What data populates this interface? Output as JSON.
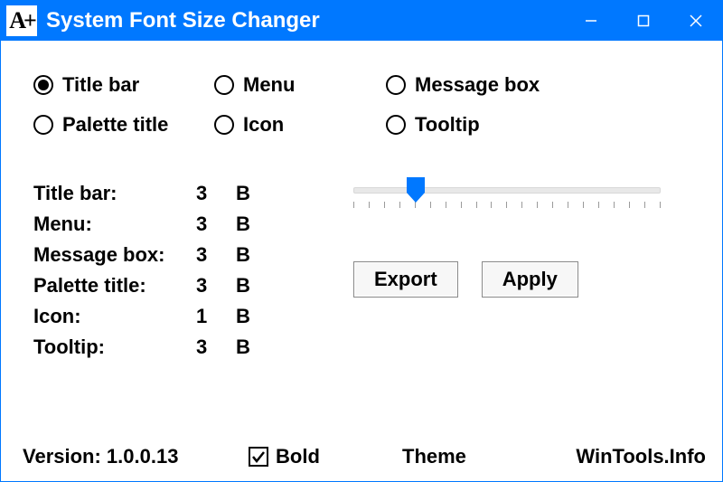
{
  "titlebar": {
    "icon_text": "A+",
    "title": "System Font Size Changer"
  },
  "radios": [
    {
      "label": "Title bar",
      "selected": true
    },
    {
      "label": "Menu",
      "selected": false
    },
    {
      "label": "Message box",
      "selected": false
    },
    {
      "label": "Palette title",
      "selected": false
    },
    {
      "label": "Icon",
      "selected": false
    },
    {
      "label": "Tooltip",
      "selected": false
    }
  ],
  "settings": [
    {
      "label": "Title bar:",
      "value": "3",
      "bold": "B"
    },
    {
      "label": "Menu:",
      "value": "3",
      "bold": "B"
    },
    {
      "label": "Message box:",
      "value": "3",
      "bold": "B"
    },
    {
      "label": "Palette title:",
      "value": "3",
      "bold": "B"
    },
    {
      "label": "Icon:",
      "value": "1",
      "bold": "B"
    },
    {
      "label": "Tooltip:",
      "value": "3",
      "bold": "B"
    }
  ],
  "slider": {
    "value": 3,
    "min": 0,
    "max": 20
  },
  "buttons": {
    "export": "Export",
    "apply": "Apply"
  },
  "footer": {
    "version_label": "Version: 1.0.0.13",
    "bold_label": "Bold",
    "bold_checked": true,
    "theme_label": "Theme",
    "wintools_label": "WinTools.Info"
  },
  "colors": {
    "accent": "#0078ff"
  }
}
